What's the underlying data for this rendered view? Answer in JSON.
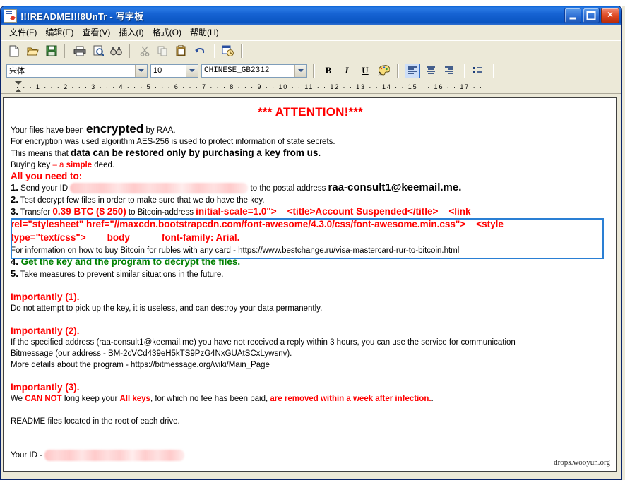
{
  "window": {
    "title": "!!!README!!!8UnTr - 写字板",
    "icon": "wordpad-document-icon",
    "buttons": {
      "minimize": "Minimize",
      "maximize": "Maximize",
      "close": "Close"
    }
  },
  "menubar": {
    "items": [
      {
        "label": "文件(F)",
        "name": "menu-file"
      },
      {
        "label": "编辑(E)",
        "name": "menu-edit"
      },
      {
        "label": "查看(V)",
        "name": "menu-view"
      },
      {
        "label": "插入(I)",
        "name": "menu-insert"
      },
      {
        "label": "格式(O)",
        "name": "menu-format"
      },
      {
        "label": "帮助(H)",
        "name": "menu-help"
      }
    ]
  },
  "toolbar": {
    "buttons": [
      {
        "name": "new-document-icon",
        "glyph": "🗋"
      },
      {
        "name": "open-folder-icon",
        "glyph": "📂"
      },
      {
        "name": "save-icon",
        "glyph": "💾"
      },
      {
        "name": "print-icon",
        "glyph": "🖶"
      },
      {
        "name": "print-preview-icon",
        "glyph": "🔍"
      },
      {
        "name": "find-icon",
        "glyph": "🔭"
      },
      {
        "name": "cut-icon",
        "glyph": "✂"
      },
      {
        "name": "copy-icon",
        "glyph": "⧉"
      },
      {
        "name": "paste-icon",
        "glyph": "📋"
      },
      {
        "name": "undo-icon",
        "glyph": "↶"
      },
      {
        "name": "date-time-icon",
        "glyph": "🗓"
      }
    ]
  },
  "formatbar": {
    "font_family": "宋体",
    "font_size": "10",
    "script": "CHINESE_GB2312",
    "bold_label": "B",
    "italic_label": "I",
    "underline_label": "U",
    "color_label": "A",
    "align_left": "align-left",
    "align_center": "align-center",
    "align_right": "align-right",
    "bullets": "bullet-list"
  },
  "ruler": {
    "ticks": "·  ·  · 1 ·  ·  · 2 ·  ·  · 3 ·  ·  · 4 ·  ·  · 5 ·  ·  · 6 ·  ·  · 7 ·  ·  · 8 ·  ·  · 9 ·  · 10 ·  · 11 ·  · 12 ·  · 13 ·  · 14 ·  · 15 ·  · 16 ·  · 17 ·  ·"
  },
  "document": {
    "attention": "*** ATTENTION!***",
    "line1": {
      "pre": "Your files have been ",
      "big": "encrypted",
      "post": " by RAA."
    },
    "line2": "For encryption was used algorithm AES-256 is used to protect information of state secrets.",
    "line3": {
      "pre": "This means that ",
      "big": "data can be restored only by purchasing a key from us."
    },
    "line4": {
      "pre": "Buying key ",
      "dash": "– ",
      "red": "a ",
      "redbold": "simple",
      "post": " deed."
    },
    "all_you_need": "All you need to:",
    "step1": {
      "num": "1.",
      "pre": " Send your ID ",
      "mid": " to the postal address ",
      "email": "raa-consult1@keemail.me."
    },
    "step2": {
      "num": "2.",
      "text": " Test decrypt few files in order to make sure that we do have the key."
    },
    "step3": {
      "num": "3.",
      "pre": " Transfer ",
      "amount": "0.39 BTC ($ 250)",
      "post": " to Bitcoin-address "
    },
    "codebox": {
      "line1": "initial-scale=1.0\">    <title>Account Suspended</title>    <link",
      "line2": "rel=\"stylesheet\" href=\"//maxcdn.bootstrapcdn.com/font-awesome/4.3.0/css/font-awesome.min.css\">    <style",
      "line3": "type=\"text/css\">        body            font-family: Arial."
    },
    "info_line": "For information on how to buy Bitcoin for rubles with any card - https://www.bestchange.ru/visa-mastercard-rur-to-bitcoin.html",
    "step4": {
      "num": "4.",
      "text": " Get the key and the program to decrypt the files."
    },
    "step5": {
      "num": "5.",
      "text": " Take measures to prevent similar situations in the future."
    },
    "importantly1": {
      "heading": "Importantly (1).",
      "body": "Do not attempt to pick up the key, it is useless, and can destroy your data permanently."
    },
    "importantly2": {
      "heading": "Importantly (2).",
      "body1": "If the specified address (raa-consult1@keemail.me) you have not received a reply within 3 hours, you can use the service for communication",
      "body2": "Bitmessage (our address - BM-2cVCd439eH5kTS9PzG4NxGUAtSCxLywsnv).",
      "body3": "More details about the program - https://bitmessage.org/wiki/Main_Page"
    },
    "importantly3": {
      "heading": "Importantly (3).",
      "pre": "We ",
      "cannot": "CAN NOT",
      "mid": " long keep your ",
      "allkeys": "All keys",
      "mid2": ", for which no fee has been paid, ",
      "removed": "are removed within a week after infection.",
      "post": "."
    },
    "readme_line": "README files located in the root of each drive.",
    "your_id_label": "Your ID - "
  },
  "watermark": "drops.wooyun.org",
  "colors": {
    "red": "#ff0000",
    "green": "#008000",
    "code_box_border": "#2a7fd4",
    "titlebar_blue": "#0a55c2",
    "window_face": "#ece9d8"
  }
}
